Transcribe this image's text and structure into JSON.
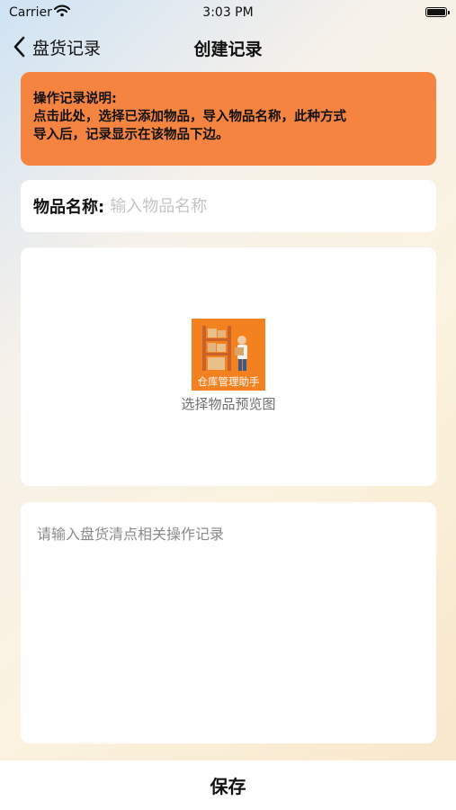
{
  "status_bar": {
    "carrier": "Carrier",
    "time": "3:03 PM"
  },
  "nav": {
    "back_label": "盘货记录",
    "title": "创建记录"
  },
  "notice": {
    "title": "操作记录说明:",
    "line1": "点击此处，选择已添加物品，导入物品名称，此种方式",
    "line2": "导入后，记录显示在该物品下边。",
    "color": "#f58440"
  },
  "item_name": {
    "label": "物品名称:",
    "placeholder": "输入物品名称",
    "value": ""
  },
  "preview": {
    "caption": "选择物品预览图",
    "icon_text": "仓库管理助手",
    "icon_color": "#f4811f"
  },
  "notes": {
    "placeholder": "请输入盘货清点相关操作记录",
    "value": ""
  },
  "footer": {
    "save_label": "保存"
  }
}
